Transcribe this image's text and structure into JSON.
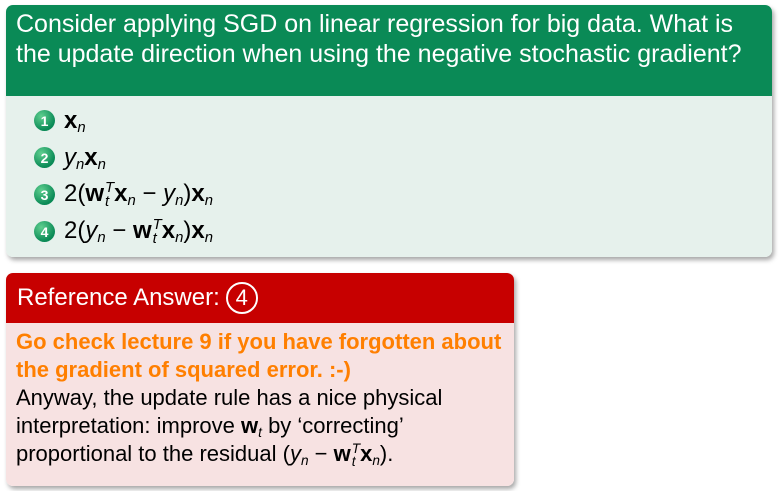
{
  "question": {
    "text": "Consider applying SGD on linear regression for big data. What is the update direction when using the negative stochastic gradient?",
    "choices": [
      {
        "number": "1",
        "text": "x_n"
      },
      {
        "number": "2",
        "text": "y_n x_n"
      },
      {
        "number": "3",
        "text": "2(w_t^T x_n − y_n)x_n"
      },
      {
        "number": "4",
        "text": "2(y_n − w_t^T x_n)x_n"
      }
    ]
  },
  "answer": {
    "header_label": "Reference Answer:",
    "answer_number": "4",
    "hint": "Go check lecture 9 if you have forgotten about the gradient of squared error. :-)",
    "explanation_part1": "Anyway, the update rule has a nice physical interpretation: improve",
    "explanation_part2": "by ‘correcting’ proportional to the residual",
    "explanation_end": "."
  },
  "colors": {
    "question_header": "#0a8a56",
    "question_body": "#e6f1ec",
    "answer_header": "#c70000",
    "answer_body": "#f7e2e2",
    "hint_text": "#ff7f00"
  }
}
